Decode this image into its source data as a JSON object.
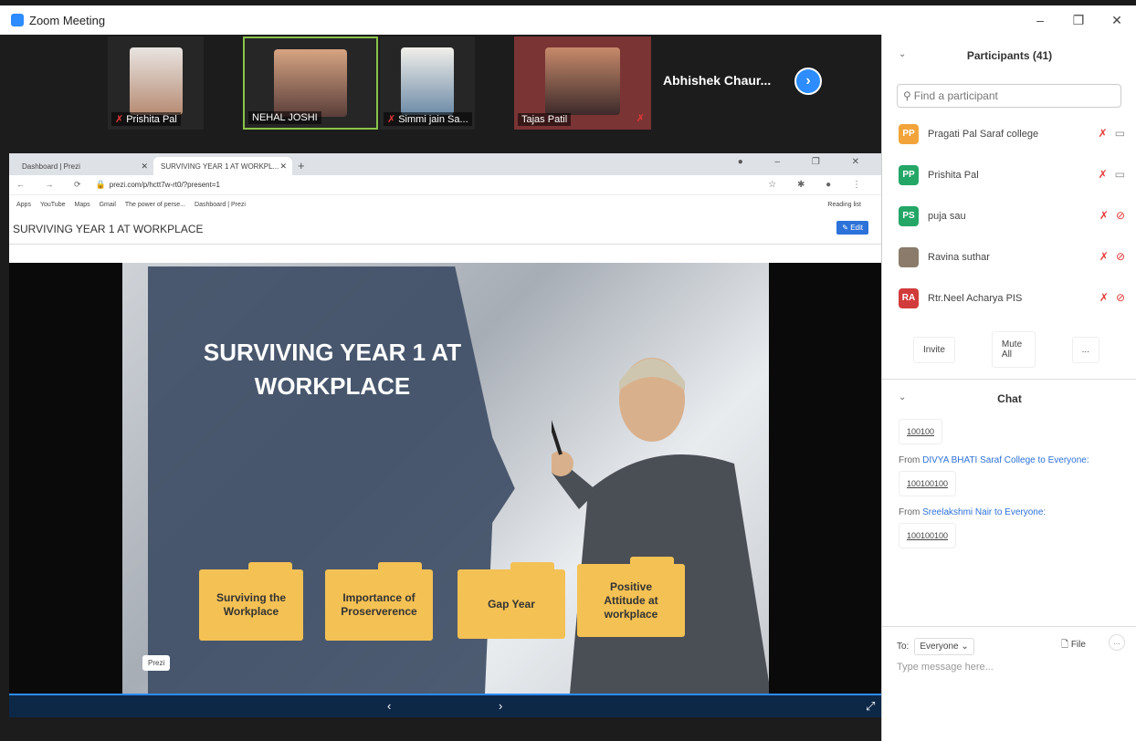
{
  "window": {
    "title": "Zoom Meeting",
    "controls": [
      "–",
      "❐",
      "✕"
    ]
  },
  "video_strip": {
    "tiles": [
      {
        "name": "Prishita Pal",
        "muted": true
      },
      {
        "name": "NEHAL JOSHI",
        "muted": false
      },
      {
        "name": "Simmi jain Sa...",
        "muted": true
      },
      {
        "name": "Tajas Patil",
        "muted": false
      }
    ],
    "extra_name": "Abhishek Chaur...",
    "next_icon": "chevron-right-icon"
  },
  "browser": {
    "tabs": [
      {
        "label": "Dashboard | Prezi"
      },
      {
        "label": "SURVIVING YEAR 1 AT WORKPL..."
      }
    ],
    "url": "prezi.com/p/hctt7w-rt0/?present=1",
    "bookmarks": [
      "Apps",
      "YouTube",
      "Maps",
      "Gmail",
      "The power of perse...",
      "Dashboard | Prezi"
    ],
    "reading_list": "Reading list"
  },
  "prezi": {
    "title": "SURVIVING YEAR 1 AT WORKPLACE",
    "edit_label": "Edit",
    "badge": "Prezi"
  },
  "slide": {
    "title_line1": "SURVIVING YEAR 1 AT",
    "title_line2": "WORKPLACE",
    "boxes": [
      {
        "line1": "Surviving the",
        "line2": "Workplace"
      },
      {
        "line1": "Importance of",
        "line2": "Proserverence"
      },
      {
        "line1": "Gap Year",
        "line2": ""
      },
      {
        "line1": "Positive",
        "line2": "Attitude at",
        "line3": "workplace"
      }
    ]
  },
  "nav": {
    "prev": "‹",
    "next": "›",
    "fullscreen": "⤢"
  },
  "participants": {
    "header": "Participants (41)",
    "search_placeholder": "Find a participant",
    "list": [
      {
        "initials": "PP",
        "name": "Pragati Pal Saraf college",
        "color": "#f2a43a",
        "video_off": false
      },
      {
        "initials": "PP",
        "name": "Prishita Pal",
        "color": "#23a666",
        "video_off": false
      },
      {
        "initials": "PS",
        "name": "puja sau",
        "color": "#23a666",
        "video_off": true
      },
      {
        "initials": "",
        "name": "Ravina suthar",
        "color": "#8a7b6a",
        "video_off": true
      },
      {
        "initials": "RA",
        "name": "Rtr.Neel Acharya PIS",
        "color": "#d23b3b",
        "video_off": true
      }
    ],
    "buttons": {
      "invite": "Invite",
      "mute_all": "Mute All",
      "more": "..."
    }
  },
  "chat": {
    "header": "Chat",
    "messages": [
      {
        "from": "",
        "text": "100100"
      },
      {
        "from": "DIVYA BHATI Saraf College",
        "to": "Everyone",
        "text": "100100100"
      },
      {
        "from": "Sreelakshmi Nair",
        "to": "Everyone",
        "text": "100100100"
      }
    ],
    "from_prefix": "From",
    "to_word": "to",
    "compose": {
      "to_label": "To:",
      "recipient": "Everyone ⌄",
      "file_label": "File",
      "more": "...",
      "placeholder": "Type message here..."
    }
  }
}
